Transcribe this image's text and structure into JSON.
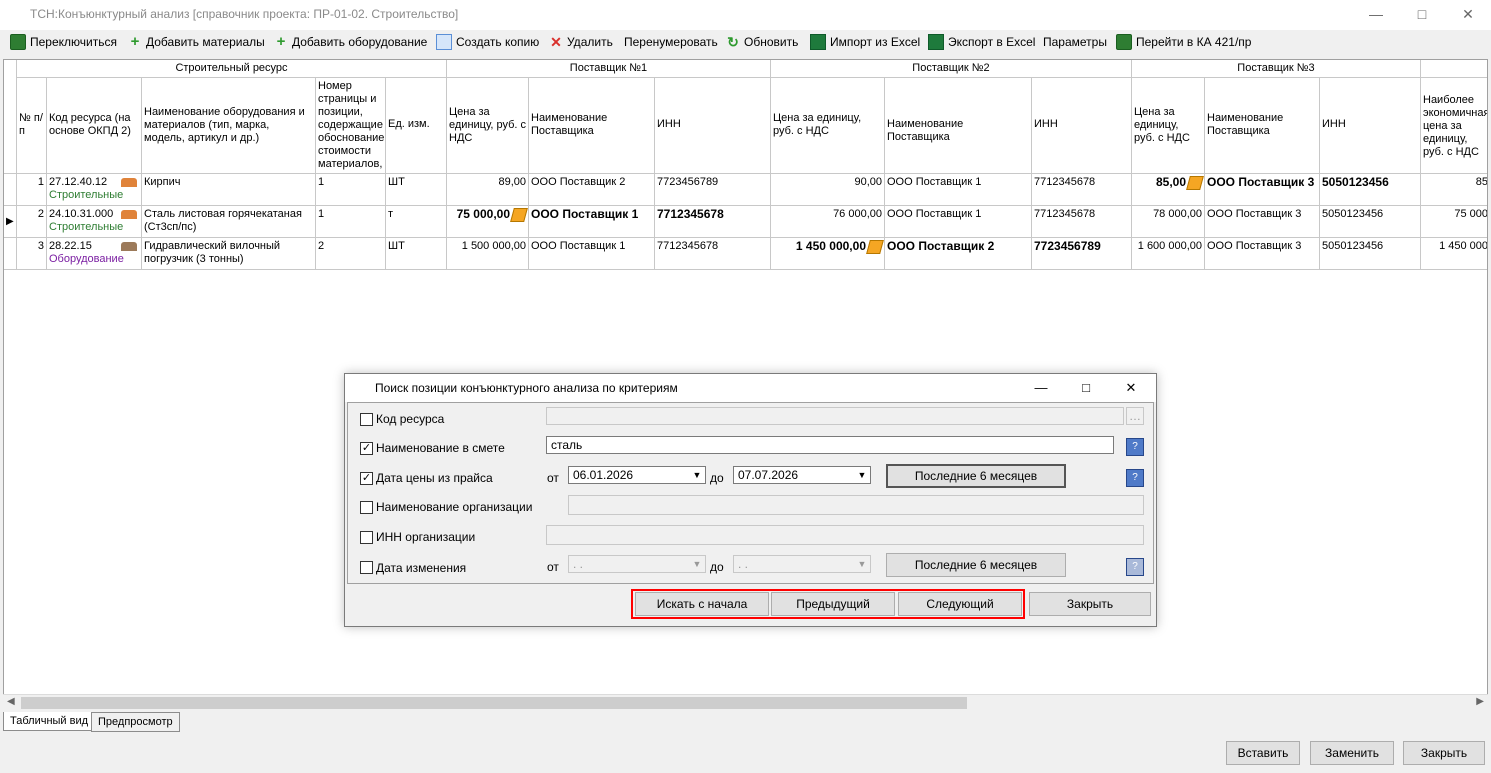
{
  "window": {
    "title": "ТСН:Конъюнктурный анализ [справочник проекта: ПР-01-02. Строительство]"
  },
  "toolbar": {
    "items": [
      {
        "label": "Переключиться",
        "icon": "ka-icon"
      },
      {
        "label": "Добавить материалы",
        "icon": "plus-icon"
      },
      {
        "label": "Добавить оборудование",
        "icon": "plus-icon"
      },
      {
        "label": "Создать копию",
        "icon": "copy-icon"
      },
      {
        "label": "Удалить",
        "icon": "delete-icon"
      },
      {
        "label": "Перенумеровать",
        "icon": ""
      },
      {
        "label": "Обновить",
        "icon": "refresh-icon"
      },
      {
        "label": "Импорт из Excel",
        "icon": "excel-icon"
      },
      {
        "label": "Экспорт в Excel",
        "icon": "excel-icon"
      },
      {
        "label": "Параметры",
        "icon": ""
      },
      {
        "label": "Перейти в КА 421/пр",
        "icon": "ka-icon"
      }
    ]
  },
  "grid": {
    "groups": {
      "resource": "Строительный ресурс",
      "supplier1": "Поставщик №1",
      "supplier2": "Поставщик №2",
      "supplier3": "Поставщик №3"
    },
    "headers": {
      "num": "№ п/п",
      "code": "Код ресурса (на основе ОКПД 2)",
      "name": "Наименование оборудования и материалов (тип, марка, модель, артикул и др.)",
      "page": "Номер страницы и позиции, содержащие обоснование стоимости материалов,",
      "unit": "Ед. изм.",
      "price1": "Цена за единицу, руб. с НДС",
      "sname1": "Наименование Поставщика",
      "inn1": "ИНН",
      "price2": "Цена за единицу, руб. с НДС",
      "sname2": "Наименование Поставщика",
      "inn2": "ИНН",
      "price3": "Цена за единицу, руб. с НДС",
      "sname3": "Наименование Поставщика",
      "inn3": "ИНН",
      "best": "Наиболее экономичная цена за единицу, руб. с НДС"
    },
    "rows": [
      {
        "num": "1",
        "code": "27.12.40.12",
        "type": "Строительные",
        "name": "Кирпич",
        "page": "1",
        "unit": "ШТ",
        "price1": "89,00",
        "sname1": "ООО Поставщик 2",
        "inn1": "7723456789",
        "price2": "90,00",
        "sname2": "ООО Поставщик 1",
        "inn2": "7712345678",
        "price3": "85,00",
        "sname3": "ООО Поставщик 3",
        "inn3": "5050123456",
        "best": "85"
      },
      {
        "num": "2",
        "code": "24.10.31.000",
        "type": "Строительные",
        "name": "Сталь листовая горячекатаная (Ст3сп/пс)",
        "page": "1",
        "unit": "т",
        "price1": "75 000,00",
        "sname1": "ООО Поставщик 1",
        "inn1": "7712345678",
        "price2": "76 000,00",
        "sname2": "ООО Поставщик 1",
        "inn2": "7712345678",
        "price3": "78 000,00",
        "sname3": "ООО Поставщик 3",
        "inn3": "5050123456",
        "best": "75 000"
      },
      {
        "num": "3",
        "code": "28.22.15",
        "type": "Оборудование",
        "name": "Гидравлический вилочный погрузчик (3 тонны)",
        "page": "2",
        "unit": "ШТ",
        "price1": "1 500 000,00",
        "sname1": "ООО Поставщик 1",
        "inn1": "7712345678",
        "price2": "1 450 000,00",
        "sname2": "ООО Поставщик 2",
        "inn2": "7723456789",
        "price3": "1 600 000,00",
        "sname3": "ООО Поставщик 3",
        "inn3": "5050123456",
        "best": "1 450 000"
      }
    ]
  },
  "tabs": [
    "Табличный вид",
    "Предпросмотр"
  ],
  "bottom_buttons": {
    "insert": "Вставить",
    "replace": "Заменить",
    "close": "Закрыть"
  },
  "dialog": {
    "title": "Поиск позиции конъюнктурного анализа по критериям",
    "criteria": {
      "code": {
        "label": "Код ресурса",
        "checked": false,
        "value": ""
      },
      "name": {
        "label": "Наименование в смете",
        "checked": true,
        "value": "сталь"
      },
      "price_date": {
        "label": "Дата цены из прайса",
        "checked": true,
        "from_label": "от",
        "from": "06.01.2026",
        "to_label": "до",
        "to": "07.07.2026",
        "last6": "Последние 6 месяцев"
      },
      "org_name": {
        "label": "Наименование организации",
        "checked": false,
        "value": ""
      },
      "org_inn": {
        "label": "ИНН организации",
        "checked": false,
        "value": ""
      },
      "change_date": {
        "label": "Дата изменения",
        "checked": false,
        "from_label": "от",
        "from": " .  .",
        "to_label": "до",
        "to": " .  .",
        "last6": "Последние 6 месяцев"
      }
    },
    "buttons": {
      "search_start": "Искать с начала",
      "prev": "Предыдущий",
      "next": "Следующий",
      "close": "Закрыть"
    }
  }
}
